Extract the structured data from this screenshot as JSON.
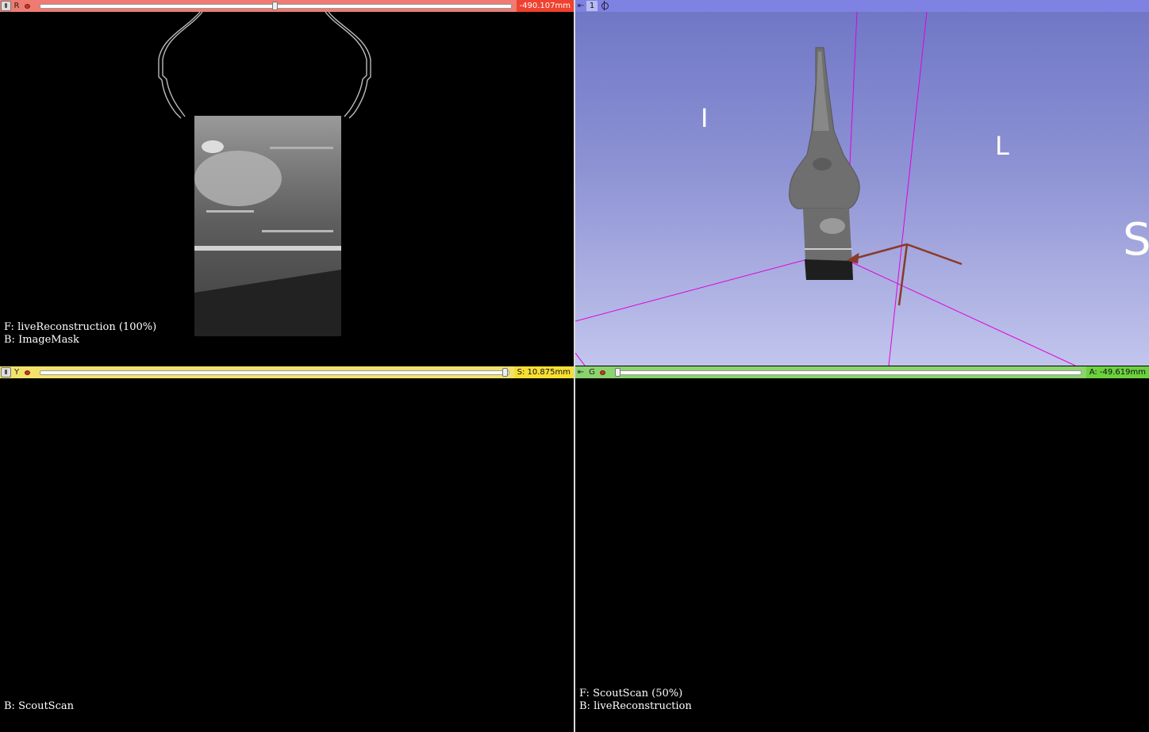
{
  "red_view": {
    "letter": "R",
    "offset": "-490.107mm",
    "slider_fraction": 0.5,
    "foreground_label": "F: liveReconstruction (100%)",
    "background_label": "B: ImageMask"
  },
  "threed_view": {
    "number": "1",
    "orientation": {
      "left_marker": "I",
      "right_marker": "L",
      "edge_marker": "S"
    }
  },
  "yellow_view": {
    "letter": "Y",
    "offset": "S: 10.875mm",
    "slider_fraction": 1.0,
    "background_label": "B: ScoutScan"
  },
  "green_view": {
    "letter": "G",
    "offset": "A: -49.619mm",
    "slider_fraction": 0.0,
    "foreground_label": "F: ScoutScan (50%)",
    "background_label": "B: liveReconstruction"
  },
  "colors": {
    "red_bar": "#ef7b72",
    "yellow_bar": "#f2e36b",
    "green_bar": "#8bd46d",
    "threed_bar": "#7f82e3",
    "plane_lines": "#e000e0"
  },
  "icons": [
    "pin-icon",
    "eye-icon",
    "target-icon"
  ]
}
